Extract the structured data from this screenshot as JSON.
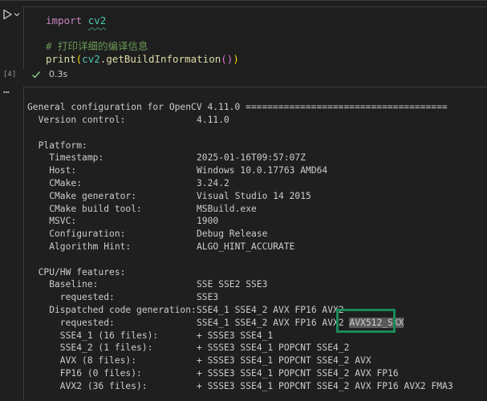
{
  "code": {
    "import_keyword": "import",
    "module": "cv2",
    "comment": "# 打印详细的编译信息",
    "print_fn": "print",
    "arg_module": "cv2",
    "call": ".getBuildInformation",
    "parens_inner": "()"
  },
  "execution": {
    "count": "[4]",
    "status_icon": "check-icon",
    "time": "0.3s"
  },
  "output": {
    "header": "General configuration for OpenCV 4.11.0 =====================================",
    "rows": [
      {
        "label": "  Version control:",
        "value": "4.11.0"
      },
      {
        "label": "",
        "value": ""
      },
      {
        "label": "  Platform:",
        "value": ""
      },
      {
        "label": "    Timestamp:",
        "value": "2025-01-16T09:57:07Z"
      },
      {
        "label": "    Host:",
        "value": "Windows 10.0.17763 AMD64"
      },
      {
        "label": "    CMake:",
        "value": "3.24.2"
      },
      {
        "label": "    CMake generator:",
        "value": "Visual Studio 14 2015"
      },
      {
        "label": "    CMake build tool:",
        "value": "MSBuild.exe"
      },
      {
        "label": "    MSVC:",
        "value": "1900"
      },
      {
        "label": "    Configuration:",
        "value": "Debug Release"
      },
      {
        "label": "    Algorithm Hint:",
        "value": "ALGO_HINT_ACCURATE"
      },
      {
        "label": "",
        "value": ""
      },
      {
        "label": "  CPU/HW features:",
        "value": ""
      },
      {
        "label": "    Baseline:",
        "value": "SSE SSE2 SSE3"
      },
      {
        "label": "      requested:",
        "value": "SSE3"
      },
      {
        "label": "    Dispatched code generation:",
        "value": "SSE4_1 SSE4_2 AVX FP16 AVX2"
      },
      {
        "label": "      requested:",
        "value": "SSE4_1 SSE4_2 AVX FP16 AVX2 ",
        "selected": "AVX512_SKX"
      },
      {
        "label": "      SSE4_1 (16 files):",
        "value": "+ SSSE3 SSE4_1"
      },
      {
        "label": "      SSE4_2 (1 files):",
        "value": "+ SSSE3 SSE4_1 POPCNT SSE4_2"
      },
      {
        "label": "      AVX (8 files):",
        "value": "+ SSSE3 SSE4_1 POPCNT SSE4_2 AVX"
      },
      {
        "label": "      FP16 (0 files):",
        "value": "+ SSSE3 SSE4_1 POPCNT SSE4_2 AVX FP16"
      },
      {
        "label": "      AVX2 (36 files):",
        "value": "+ SSSE3 SSE4_1 POPCNT SSE4_2 AVX FP16 AVX2 FMA3"
      }
    ]
  },
  "colors": {
    "background": "#1f1f1f",
    "highlight_border": "#1a8a5a",
    "success": "#4ec9b0"
  }
}
